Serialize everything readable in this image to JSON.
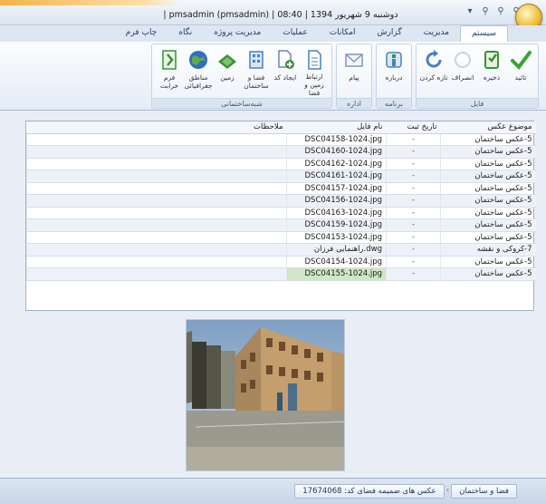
{
  "window": {
    "title": "| pmsadmin (pmsadmin) | 08:40 | 1394 دوشنبه 9 شهریور",
    "qat_icons": [
      "search-icon",
      "search-icon",
      "search-icon",
      "dropdown-icon"
    ]
  },
  "tabs": [
    {
      "label": "سیستم",
      "active": true
    },
    {
      "label": "مدیریت",
      "active": false
    },
    {
      "label": "گزارش",
      "active": false
    },
    {
      "label": "امکانات",
      "active": false
    },
    {
      "label": "عملیات",
      "active": false
    },
    {
      "label": "مدیریت پروژه",
      "active": false
    },
    {
      "label": "نگاه",
      "active": false
    },
    {
      "label": "چاپ فرم",
      "active": false
    }
  ],
  "ribbon": {
    "groups": [
      {
        "label": "فایل",
        "buttons": [
          {
            "label": "تائید",
            "icon": "check-icon",
            "color": "#3aa336"
          },
          {
            "label": "ذخیره",
            "icon": "save-icon",
            "color": "#3a8f3a"
          },
          {
            "label": "انصراف",
            "icon": "cancel-icon",
            "color": "#c9d3df"
          },
          {
            "label": "تازه کردن",
            "icon": "refresh-icon",
            "color": "#4b7fc2"
          }
        ]
      },
      {
        "label": "برنامه",
        "buttons": [
          {
            "label": "درباره",
            "icon": "about-icon",
            "color": "#4b7fc2"
          }
        ]
      },
      {
        "label": "اداره",
        "buttons": [
          {
            "label": "پیام",
            "icon": "mail-icon",
            "color": "#7e97bd"
          }
        ]
      },
      {
        "label": "شبه‌ساختمانی",
        "buttons": [
          {
            "label": "ارتباط زمین و فضا",
            "icon": "document-icon",
            "color": "#4b7fc2"
          },
          {
            "label": "ایجاد کد",
            "icon": "add-doc-icon",
            "color": "#3a8f3a"
          },
          {
            "label": "فضا و ساختمان",
            "icon": "building-icon",
            "color": "#4b7fc2"
          },
          {
            "label": "زمین",
            "icon": "land-icon",
            "color": "#3a8f3a"
          },
          {
            "label": "مناطق جغرافیائی",
            "icon": "globe-icon",
            "color": "#2f6ec4"
          },
          {
            "label": "فرم خرابت",
            "icon": "form-icon",
            "color": "#3a8f3a"
          }
        ]
      }
    ]
  },
  "table": {
    "headers": {
      "subject": "موضوع عکس",
      "date": "تاریخ ثبت",
      "file": "نام فایل",
      "notes": "ملاحظات"
    },
    "rows": [
      {
        "subject": "5-عکس ساختمان",
        "date": "-",
        "file": "DSC04158-1024.jpg",
        "notes": ""
      },
      {
        "subject": "5-عکس ساختمان",
        "date": "-",
        "file": "DSC04160-1024.jpg",
        "notes": ""
      },
      {
        "subject": "5-عکس ساختمان",
        "date": "-",
        "file": "DSC04162-1024.jpg",
        "notes": ""
      },
      {
        "subject": "5-عکس ساختمان",
        "date": "-",
        "file": "DSC04161-1024.jpg",
        "notes": ""
      },
      {
        "subject": "5-عکس ساختمان",
        "date": "-",
        "file": "DSC04157-1024.jpg",
        "notes": ""
      },
      {
        "subject": "5-عکس ساختمان",
        "date": "-",
        "file": "DSC04156-1024.jpg",
        "notes": ""
      },
      {
        "subject": "5-عکس ساختمان",
        "date": "-",
        "file": "DSC04163-1024.jpg",
        "notes": ""
      },
      {
        "subject": "5-عکس ساختمان",
        "date": "-",
        "file": "DSC04159-1024.jpg",
        "notes": ""
      },
      {
        "subject": "5-عکس ساختمان",
        "date": "-",
        "file": "DSC04153-1024.jpg",
        "notes": ""
      },
      {
        "subject": "7-کروکی و نقشه",
        "date": "-",
        "file": "راهنمایی فرزان.dwg",
        "notes": ""
      },
      {
        "subject": "5-عکس ساختمان",
        "date": "-",
        "file": "DSC04154-1024.jpg",
        "notes": ""
      },
      {
        "subject": "5-عکس ساختمان",
        "date": "-",
        "file": "DSC04155-1024.jpg",
        "notes": ""
      }
    ],
    "selected_index": 11
  },
  "statusbar": {
    "crumb_space": "فضا و ساختمان",
    "crumb_photos": "عکس های ضمیمه فضای کد: 17674068"
  }
}
